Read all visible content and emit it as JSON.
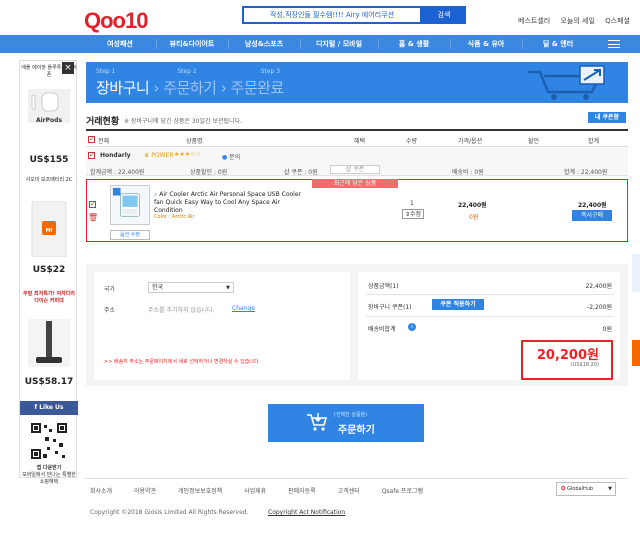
{
  "header": {
    "logo": "Qoo10",
    "search_text": "작성,직장인들 필수템!!!! Airy 에어리쿠션",
    "search_button": "검색",
    "top_links": [
      "베스트셀러",
      "오늘의 세일",
      "Q스페셜"
    ]
  },
  "nav": {
    "items": [
      "여성패션",
      "뷰티&다이어트",
      "남성&스포츠",
      "디지털 / 모바일",
      "홈 & 생활",
      "식품 & 유아",
      "딜 & 엔터"
    ]
  },
  "sidebar": {
    "close": "×",
    "ad1_text": "애플 에어팟 플루투스 이어폰",
    "ad1_img": "AirPods",
    "ad1_price": "US$155",
    "ad2_text": "샤오미 보조배터리 2C",
    "ad2_img": "MI",
    "ad2_price": "US$22",
    "ad3_text": "주말 최저특가! 여자다리 다이슨 커피대",
    "ad3_price": "US$58.17",
    "like_us": "Like Us",
    "app_download": "앱 다운받기",
    "app_note": "모바일에서 만나는 특별한 쇼핑혜택"
  },
  "steps": {
    "labels": [
      "Step 1",
      "Step 2",
      "Step 3"
    ],
    "titles": [
      "장바구니",
      "주문하기",
      "주문완료"
    ]
  },
  "cart": {
    "title": "거래현황",
    "note": "※ 장바구니에 담긴 상품은 30일간 보관됩니다.",
    "coupon_button": "내 쿠폰함",
    "columns": [
      "전체",
      "상품명",
      "혜택",
      "수량",
      "가격/옵션",
      "할인",
      "합계"
    ],
    "seller": {
      "name": "Hondarly",
      "power": "POWER",
      "stars": "★★★☆☆",
      "inquiry": "문의",
      "subtotal": "합계금액 : 22,400원",
      "product_discount": "상품할인 : 0원",
      "coupon": "샵 쿠폰 : 0원",
      "coupon_button": "샵 쿠폰",
      "shipping": "배송비 : 0원",
      "total": "합계 : 22,400원"
    },
    "item": {
      "tag": "최근에 담은 상품",
      "name": "Air Cooler Arctic Air Personal Space USB Cooler fan Quick Easy Way to Cool Any Space Air Condition",
      "color": "Color : Arctic Air",
      "option_button": "옵션 수정",
      "qty": "1",
      "qty_button": "수정",
      "price": "22,400원",
      "discount": "0원",
      "total": "22,400원",
      "buy_now": "즉시구매"
    }
  },
  "address": {
    "country_label": "국가",
    "country_value": "한국",
    "address_label": "주소",
    "address_placeholder": "주소를 추가하지 않습니다.",
    "change_link": "Change",
    "note": ">> 배송지 주소는 주문페이지에서 새로 선택하거나 변경하실 수 있습니다."
  },
  "summary": {
    "product_amount_label": "상품금액(1)",
    "product_amount": "22,400원",
    "cart_coupon_label": "장바구니 쿠폰(1)",
    "cart_coupon_button": "쿠폰 적용하기",
    "cart_coupon": "-2,200원",
    "shipping_label": "배송비합계",
    "shipping": "0원",
    "grand_total": "20,200원",
    "usd_total": "(US$18.20)"
  },
  "order": {
    "small": "(선택한 상품을)",
    "big": "주문하기"
  },
  "footer": {
    "links": [
      "회사소개",
      "이용약관",
      "개인정보보호정책",
      "사업제휴",
      "판매자등록",
      "고객센터",
      "Qsafe 프로그램"
    ],
    "globalhub": "GlobalHub",
    "copyright": "Copyright ©2018 Giosis Limited  All Rights Reserved.",
    "copyright_link": "Copyright Act Notification"
  },
  "colors": {
    "brand_red": "#e3202b",
    "accent_blue": "#2f84e4",
    "nav_blue": "#3c87e0"
  }
}
